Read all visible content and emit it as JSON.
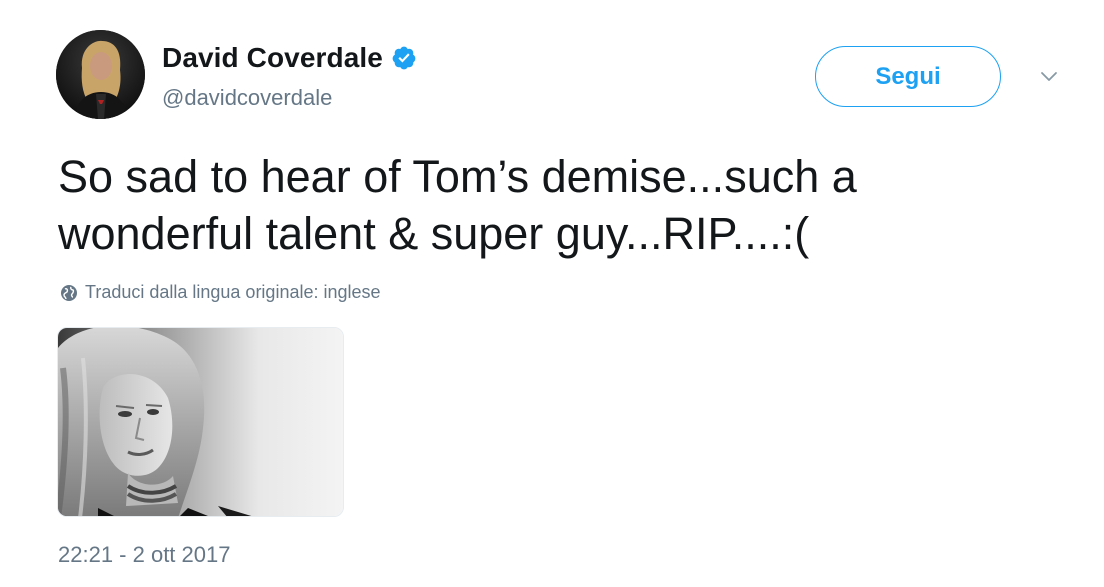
{
  "tweet": {
    "author": {
      "display_name": "David Coverdale",
      "handle": "@davidcoverdale",
      "verified": true,
      "verified_icon": "verified-badge-icon",
      "avatar_icon": "profile-avatar"
    },
    "follow_label": "Segui",
    "menu_icon": "chevron-down-icon",
    "text_line1": "So sad to hear of Tom’s demise...such a",
    "text_line2": "wonderful talent & super guy...RIP....:(",
    "translate_label": "Traduci dalla lingua originale: inglese",
    "translate_icon": "globe-icon",
    "timestamp": "22:21 - 2 ott 2017"
  },
  "colors": {
    "accent": "#1da1f2",
    "text_primary": "#14171a",
    "text_secondary": "#657786"
  }
}
